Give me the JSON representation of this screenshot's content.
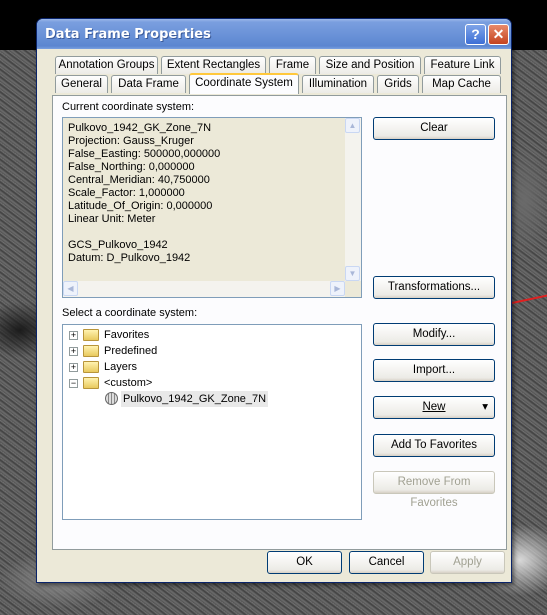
{
  "window": {
    "title": "Data Frame Properties",
    "help_symbol": "?",
    "close_symbol": "✕"
  },
  "tabs_row1": [
    "Annotation Groups",
    "Extent Rectangles",
    "Frame",
    "Size and Position",
    "Feature Link"
  ],
  "tabs_row2": [
    "General",
    "Data Frame",
    "Coordinate System",
    "Illumination",
    "Grids",
    "Map Cache"
  ],
  "active_tab": "Coordinate System",
  "current_cs": {
    "label": "Current coordinate system:",
    "lines": [
      "Pulkovo_1942_GK_Zone_7N",
      "Projection: Gauss_Kruger",
      "False_Easting: 500000,000000",
      "False_Northing: 0,000000",
      "Central_Meridian: 40,750000",
      "Scale_Factor: 1,000000",
      "Latitude_Of_Origin: 0,000000",
      "Linear Unit: Meter",
      "",
      "GCS_Pulkovo_1942",
      "Datum: D_Pulkovo_1942"
    ]
  },
  "select_cs": {
    "label": "Select a coordinate system:",
    "tree": [
      {
        "label": "Favorites",
        "expander": "+",
        "level": 0
      },
      {
        "label": "Predefined",
        "expander": "+",
        "level": 0
      },
      {
        "label": "Layers",
        "expander": "+",
        "level": 0
      },
      {
        "label": "<custom>",
        "expander": "−",
        "level": 0
      },
      {
        "label": "Pulkovo_1942_GK_Zone_7N",
        "expander": "",
        "level": 1
      }
    ]
  },
  "buttons": {
    "clear": "Clear",
    "transformations": "Transformations...",
    "modify": "Modify...",
    "import": "Import...",
    "new": "New",
    "add_to_favorites": "Add To Favorites",
    "remove_from_favorites": "Remove From Favorites"
  },
  "dialog_buttons": {
    "ok": "OK",
    "cancel": "Cancel",
    "apply": "Apply"
  },
  "icons": {
    "scroll_up": "▲",
    "scroll_down": "▼",
    "scroll_left": "◀",
    "scroll_right": "▶",
    "dropdown_arrow": "▾"
  }
}
